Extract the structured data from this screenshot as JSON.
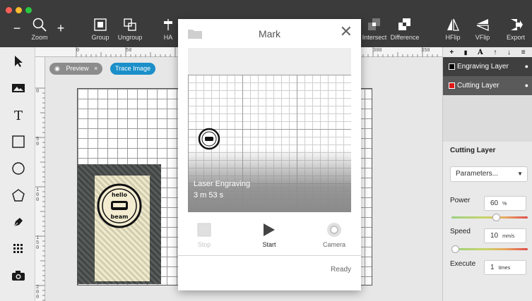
{
  "toolbar": {
    "zoom_label": "Zoom",
    "group_label": "Group",
    "ungroup_label": "Ungroup",
    "align_partial_label": "HA",
    "intersect_label": "Intersect",
    "difference_label": "Difference",
    "hflip_label": "HFlip",
    "vflip_label": "VFlip",
    "export_label": "Export",
    "zoom_out_glyph": "−",
    "zoom_in_glyph": "+"
  },
  "left_tools": [
    "pointer-icon",
    "image-icon",
    "text-icon",
    "rectangle-icon",
    "ellipse-icon",
    "polygon-icon",
    "pen-icon",
    "grid-array-icon",
    "camera-icon"
  ],
  "ruler": {
    "top_labels": [
      "0",
      "50",
      "300",
      "350"
    ],
    "left_labels": [
      "0",
      "50",
      "100",
      "150",
      "200"
    ]
  },
  "canvas": {
    "preview_pill": "Preview",
    "preview_close": "×",
    "trace_pill": "Trace Image",
    "sticker_text_top": "hello",
    "sticker_text_bottom": "beam"
  },
  "modal": {
    "title": "Mark",
    "close_glyph": "✕",
    "status_title": "Laser Engraving",
    "status_time": "3 m 53 s",
    "stop_label": "Stop",
    "start_label": "Start",
    "camera_label": "Camera",
    "footer_status": "Ready"
  },
  "layers": {
    "tools": [
      "+",
      "🗑",
      "A",
      "↑",
      "↓",
      "≡"
    ],
    "items": [
      {
        "name": "Engraving Layer",
        "color": "#000000",
        "visible_glyph": "👁"
      },
      {
        "name": "Cutting Layer",
        "color": "#e01818",
        "visible_glyph": "👁"
      }
    ]
  },
  "properties": {
    "section_title": "Cutting Layer",
    "preset": "Parameters...",
    "power": {
      "label": "Power",
      "value": "60",
      "unit": "%",
      "level": 0.6
    },
    "speed": {
      "label": "Speed",
      "value": "10",
      "unit": "mm/s",
      "level": 0.0
    },
    "execute": {
      "label": "Execute",
      "value": "1",
      "unit": "times"
    }
  },
  "colors": {
    "toolbar_bg": "#3b3b3b",
    "accent_blue": "#1a8fc9",
    "selected_layer_bg": "#5a5a5a",
    "unselected_layer_bg": "#3f3f3f"
  }
}
